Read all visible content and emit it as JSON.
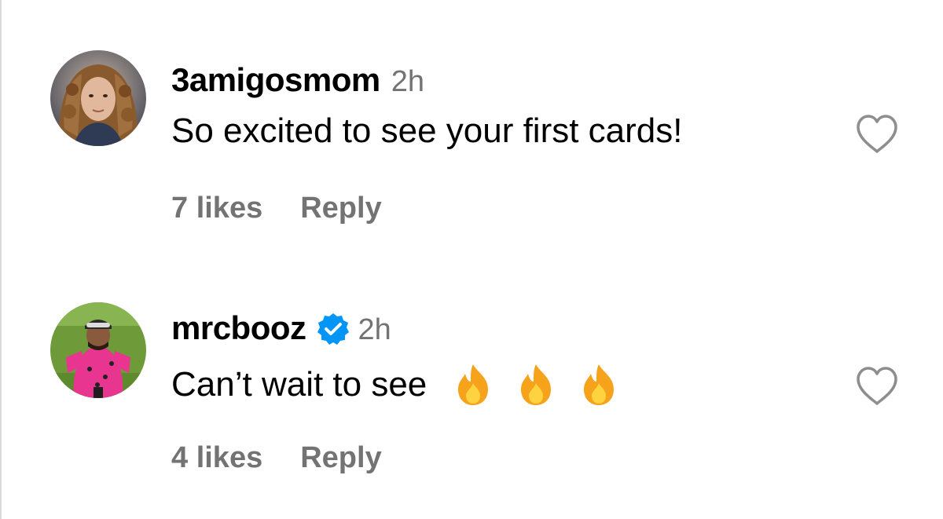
{
  "comments": [
    {
      "username": "3amigosmom",
      "time": "2h",
      "text": "So excited to see your first cards!",
      "likes": "7 likes",
      "reply_label": "Reply",
      "verified": false
    },
    {
      "username": "mrcbooz",
      "time": "2h",
      "text": "Can’t wait to see",
      "emojis": [
        "fire-emoji",
        "fire-emoji",
        "fire-emoji"
      ],
      "likes": "4 likes",
      "reply_label": "Reply",
      "verified": true
    }
  ],
  "icons": {
    "like": "heart-outline-icon",
    "verified": "verified-badge-icon"
  },
  "colors": {
    "secondary_text": "#737373",
    "verified_blue": "#0095f6",
    "fire_outer": "#f7a21b",
    "fire_inner": "#ffd23f"
  }
}
